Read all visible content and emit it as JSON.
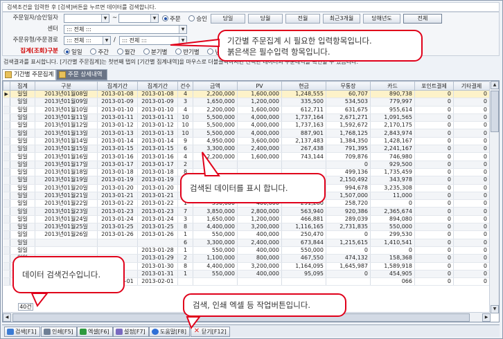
{
  "top_hint": "검색조건을 입력한 후 [검색]버튼을 누르면 데이터를 검색합니다.",
  "search": {
    "date_label": "주문일자/승인일자",
    "date_from": "",
    "date_sep": "~",
    "date_to": "",
    "date_type": [
      {
        "label": "주문",
        "selected": true
      },
      {
        "label": "승인",
        "selected": false
      }
    ],
    "period_buttons": [
      "당일",
      "당월",
      "전월",
      "최근3개월",
      "당해년도",
      "전체"
    ],
    "center_label": "센터",
    "center_value": "::: 전체 :::",
    "type_label": "주문유형/주문경로",
    "type_value": "::: 전체 :::",
    "type_sep": "/",
    "path_value": "::: 전체 :::",
    "group_label": "집계(조회)구분",
    "group_options": [
      {
        "label": "일일",
        "selected": true
      },
      {
        "label": "주간",
        "selected": false
      },
      {
        "label": "월간",
        "selected": false
      },
      {
        "label": "분기별",
        "selected": false
      },
      {
        "label": "반기별",
        "selected": false
      },
      {
        "label": "년간",
        "selected": false
      }
    ]
  },
  "result_hint": "검색결과를 표시합니다. [기간별 주문집계]는 첫번째 탭의 [기간별 집계내역]을 마우스로 더블클릭하시면 선택한 데이터의 주문내역을 확인할 수 있습니다.",
  "tabs": [
    {
      "label": "기간별 주문집계",
      "active": true
    },
    {
      "label": "주문 상세내역",
      "active": false
    }
  ],
  "grid": {
    "columns": [
      "집계",
      "구분",
      "집계기간",
      "집계기간",
      "건수",
      "금액",
      "PV",
      "현금",
      "무통장",
      "카드",
      "포인트결제",
      "기타결제"
    ],
    "rows": [
      [
        "일일",
        "2013년01월08일",
        "2013-01-08",
        "2013-01-08",
        "4",
        "2,200,000",
        "1,600,000",
        "1,248,555",
        "60,707",
        "890,738",
        "0",
        "0"
      ],
      [
        "일일",
        "2013년01월09일",
        "2013-01-09",
        "2013-01-09",
        "3",
        "1,650,000",
        "1,200,000",
        "335,500",
        "534,503",
        "779,997",
        "0",
        "0"
      ],
      [
        "일일",
        "2013년01월10일",
        "2013-01-10",
        "2013-01-10",
        "4",
        "2,200,000",
        "1,600,000",
        "612,711",
        "631,675",
        "955,614",
        "0",
        "0"
      ],
      [
        "일일",
        "2013년01월11일",
        "2013-01-11",
        "2013-01-11",
        "10",
        "5,500,000",
        "4,000,000",
        "1,737,164",
        "2,671,271",
        "1,091,565",
        "0",
        "0"
      ],
      [
        "일일",
        "2013년01월12일",
        "2013-01-12",
        "2013-01-12",
        "10",
        "5,500,000",
        "4,000,000",
        "1,737,163",
        "1,592,672",
        "2,170,175",
        "0",
        "0"
      ],
      [
        "일일",
        "2013년01월13일",
        "2013-01-13",
        "2013-01-13",
        "10",
        "5,500,000",
        "4,000,000",
        "887,901",
        "1,768,125",
        "2,843,974",
        "0",
        "0"
      ],
      [
        "일일",
        "2013년01월14일",
        "2013-01-14",
        "2013-01-14",
        "9",
        "4,950,000",
        "3,600,000",
        "2,137,483",
        "1,384,350",
        "1,428,167",
        "0",
        "0"
      ],
      [
        "일일",
        "2013년01월15일",
        "2013-01-15",
        "2013-01-15",
        "6",
        "3,300,000",
        "2,400,000",
        "267,438",
        "791,395",
        "2,241,167",
        "0",
        "0"
      ],
      [
        "일일",
        "2013년01월16일",
        "2013-01-16",
        "2013-01-16",
        "4",
        "2,200,000",
        "1,600,000",
        "743,144",
        "709,876",
        "746,980",
        "0",
        "0"
      ],
      [
        "일일",
        "2013년01월17일",
        "2013-01-17",
        "2013-01-17",
        "2",
        "",
        "",
        "",
        "0",
        "929,500",
        "0",
        "0"
      ],
      [
        "일일",
        "2013년01월18일",
        "2013-01-18",
        "2013-01-18",
        "8",
        "",
        "",
        "",
        "499,136",
        "1,735,459",
        "0",
        "0"
      ],
      [
        "일일",
        "2013년01월19일",
        "2013-01-19",
        "2013-01-19",
        "5",
        "",
        "",
        "",
        "2,150,492",
        "343,978",
        "0",
        "0"
      ],
      [
        "일일",
        "2013년01월20일",
        "2013-01-20",
        "2013-01-20",
        "10",
        "",
        "",
        "",
        "994,678",
        "3,235,308",
        "0",
        "0"
      ],
      [
        "일일",
        "2013년01월21일",
        "2013-01-21",
        "2013-01-21",
        "3",
        "",
        "",
        "",
        "1,507,000",
        "11,000",
        "0",
        "0"
      ],
      [
        "일일",
        "2013년01월22일",
        "2013-01-22",
        "2013-01-22",
        "1",
        "550,000",
        "400,000",
        "291,280",
        "258,720",
        "0",
        "0",
        "0"
      ],
      [
        "일일",
        "2013년01월23일",
        "2013-01-23",
        "2013-01-23",
        "7",
        "3,850,000",
        "2,800,000",
        "563,940",
        "920,386",
        "2,365,674",
        "0",
        "0"
      ],
      [
        "일일",
        "2013년01월24일",
        "2013-01-24",
        "2013-01-24",
        "3",
        "1,650,000",
        "1,200,000",
        "466,881",
        "289,039",
        "894,080",
        "0",
        "0"
      ],
      [
        "일일",
        "2013년01월25일",
        "2013-01-25",
        "2013-01-25",
        "8",
        "4,400,000",
        "3,200,000",
        "1,116,165",
        "2,731,835",
        "550,000",
        "0",
        "0"
      ],
      [
        "일일",
        "2013년01월26일",
        "2013-01-26",
        "2013-01-26",
        "1",
        "550,000",
        "400,000",
        "250,470",
        "0",
        "299,530",
        "0",
        "0"
      ],
      [
        "일일",
        "",
        "",
        "",
        "6",
        "3,300,000",
        "2,400,000",
        "673,844",
        "1,215,615",
        "1,410,541",
        "0",
        "0"
      ],
      [
        "일일",
        "",
        "",
        "2013-01-28",
        "1",
        "550,000",
        "400,000",
        "550,000",
        "0",
        "0",
        "0",
        "0"
      ],
      [
        "일일",
        "",
        "",
        "2013-01-29",
        "2",
        "1,100,000",
        "800,000",
        "467,550",
        "474,132",
        "158,368",
        "0",
        "0"
      ],
      [
        "일일",
        "",
        "",
        "2013-01-30",
        "8",
        "4,400,000",
        "3,200,000",
        "1,164,095",
        "1,645,987",
        "1,589,918",
        "0",
        "0"
      ],
      [
        "일일",
        "",
        "",
        "2013-01-31",
        "1",
        "550,000",
        "400,000",
        "95,095",
        "0",
        "454,905",
        "0",
        "0"
      ],
      [
        "일일",
        "2013년02월01일",
        "2013-02-01",
        "2013-02-01",
        "",
        "",
        "",
        "",
        "",
        "066",
        "0",
        "0"
      ]
    ],
    "count": "40건"
  },
  "bottom_buttons": [
    {
      "label": "검색[F1]",
      "icon": "search-icon",
      "color": "#3b7bd4"
    },
    {
      "label": "인쇄[F5]",
      "icon": "print-icon",
      "color": "#6f7f95"
    },
    {
      "label": "엑셀[F6]",
      "icon": "excel-icon",
      "color": "#2e9a3f"
    },
    {
      "label": "설정[F7]",
      "icon": "settings-icon",
      "color": "#7a6ac0"
    },
    {
      "label": "도움말[F8]",
      "icon": "help-icon",
      "color": "#2f6fd6"
    },
    {
      "label": "닫기[F12]",
      "icon": "close-icon",
      "color": "#d22"
    }
  ],
  "callouts": {
    "search": [
      "기간별 주문집계 시 필요한 입력항목입니다.",
      "붉은색은 필수입력 항목입니다."
    ],
    "grid": "검색된 데이터를 표시 합니다.",
    "count": "데이터 검색건수입니다.",
    "buttons": "검색, 인쇄 엑셀 등 작업버튼입니다."
  }
}
